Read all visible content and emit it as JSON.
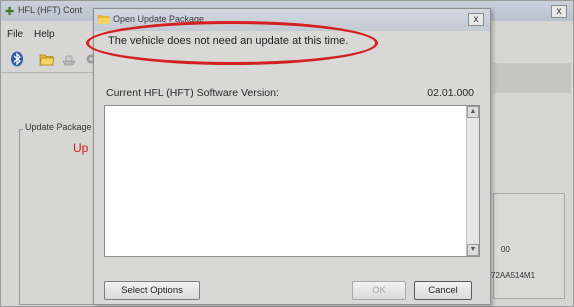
{
  "main_window": {
    "title": "HFL (HFT) Cont",
    "close_label": "x",
    "menu": [
      "File",
      "Help"
    ],
    "update_package_label": "Update Package",
    "red_status_text": "Up",
    "right_values": [
      "00",
      "72AA514M1"
    ]
  },
  "dialog": {
    "title": "Open Update Package",
    "close_label": "x",
    "message": "The vehicle does not need an update at this time.",
    "version_label": "Current HFL (HFT) Software Version:",
    "version_value": "02.01.000",
    "textarea_content": "",
    "buttons": {
      "select_options": "Select Options",
      "ok": "OK",
      "cancel": "Cancel"
    }
  },
  "colors": {
    "highlight_ellipse": "#d42020",
    "status_red": "#d21a1a"
  },
  "icons": [
    "bluetooth-icon",
    "folder-icon",
    "ship-icon",
    "gear-icon",
    "close-icon",
    "scroll-up-icon",
    "scroll-down-icon"
  ]
}
